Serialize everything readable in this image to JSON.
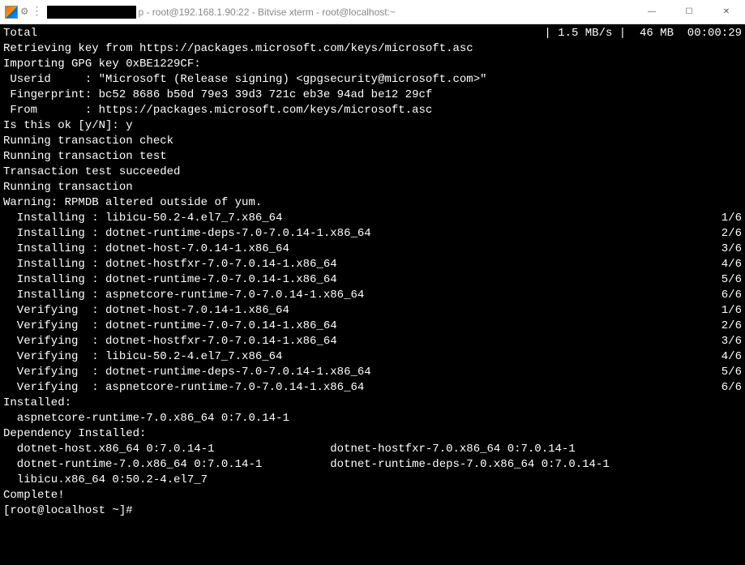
{
  "titlebar": {
    "title_suffix": "p - root@192.168.1.90:22 - Bitvise xterm - root@localhost:~",
    "minimize": "—",
    "maximize": "☐",
    "close": "✕"
  },
  "terminal": {
    "lines": [
      {
        "left": "Total",
        "right": "| 1.5 MB/s |  46 MB  00:00:29"
      },
      {
        "left": "Retrieving key from https://packages.microsoft.com/keys/microsoft.asc"
      },
      {
        "left": "Importing GPG key 0xBE1229CF:"
      },
      {
        "left": " Userid     : \"Microsoft (Release signing) <gpgsecurity@microsoft.com>\""
      },
      {
        "left": " Fingerprint: bc52 8686 b50d 79e3 39d3 721c eb3e 94ad be12 29cf"
      },
      {
        "left": " From       : https://packages.microsoft.com/keys/microsoft.asc"
      },
      {
        "left": "Is this ok [y/N]: y"
      },
      {
        "left": "Running transaction check"
      },
      {
        "left": "Running transaction test"
      },
      {
        "left": "Transaction test succeeded"
      },
      {
        "left": "Running transaction"
      },
      {
        "left": "Warning: RPMDB altered outside of yum."
      },
      {
        "left": "  Installing : libicu-50.2-4.el7_7.x86_64",
        "right": "1/6"
      },
      {
        "left": "  Installing : dotnet-runtime-deps-7.0-7.0.14-1.x86_64",
        "right": "2/6"
      },
      {
        "left": "  Installing : dotnet-host-7.0.14-1.x86_64",
        "right": "3/6"
      },
      {
        "left": "  Installing : dotnet-hostfxr-7.0-7.0.14-1.x86_64",
        "right": "4/6"
      },
      {
        "left": "  Installing : dotnet-runtime-7.0-7.0.14-1.x86_64",
        "right": "5/6"
      },
      {
        "left": "  Installing : aspnetcore-runtime-7.0-7.0.14-1.x86_64",
        "right": "6/6"
      },
      {
        "left": "  Verifying  : dotnet-host-7.0.14-1.x86_64",
        "right": "1/6"
      },
      {
        "left": "  Verifying  : dotnet-runtime-7.0-7.0.14-1.x86_64",
        "right": "2/6"
      },
      {
        "left": "  Verifying  : dotnet-hostfxr-7.0-7.0.14-1.x86_64",
        "right": "3/6"
      },
      {
        "left": "  Verifying  : libicu-50.2-4.el7_7.x86_64",
        "right": "4/6"
      },
      {
        "left": "  Verifying  : dotnet-runtime-deps-7.0-7.0.14-1.x86_64",
        "right": "5/6"
      },
      {
        "left": "  Verifying  : aspnetcore-runtime-7.0-7.0.14-1.x86_64",
        "right": "6/6"
      },
      {
        "left": ""
      },
      {
        "left": "Installed:"
      },
      {
        "left": "  aspnetcore-runtime-7.0.x86_64 0:7.0.14-1"
      },
      {
        "left": ""
      },
      {
        "left": "Dependency Installed:"
      },
      {
        "left": "  dotnet-host.x86_64 0:7.0.14-1                 dotnet-hostfxr-7.0.x86_64 0:7.0.14-1"
      },
      {
        "left": "  dotnet-runtime-7.0.x86_64 0:7.0.14-1          dotnet-runtime-deps-7.0.x86_64 0:7.0.14-1"
      },
      {
        "left": "  libicu.x86_64 0:50.2-4.el7_7"
      },
      {
        "left": ""
      },
      {
        "left": "Complete!"
      },
      {
        "left": "[root@localhost ~]#"
      }
    ]
  }
}
